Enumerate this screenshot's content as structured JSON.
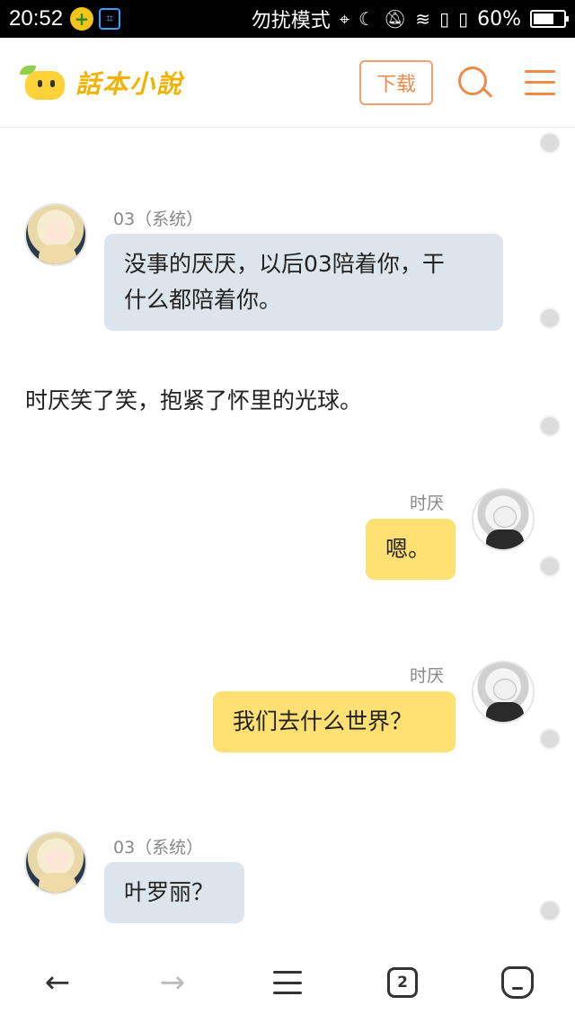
{
  "status_bar": {
    "time": "20:52",
    "mode": "勿扰模式",
    "battery": "60%",
    "battery_level": 0.6
  },
  "header": {
    "logo_text": "話本小說",
    "download_label": "下载"
  },
  "messages": [
    {
      "type": "bubble",
      "side": "left",
      "sender": "03（系统）",
      "lines": [
        "没事的厌厌，以后03陪着你，干",
        "什么都陪着你。"
      ]
    },
    {
      "type": "narration",
      "text": "时厌笑了笑，抱紧了怀里的光球。"
    },
    {
      "type": "bubble",
      "side": "right",
      "sender": "时厌",
      "lines": [
        "嗯。"
      ]
    },
    {
      "type": "bubble",
      "side": "right",
      "sender": "时厌",
      "lines": [
        "我们去什么世界？"
      ]
    },
    {
      "type": "bubble",
      "side": "left",
      "sender": "03（系统）",
      "lines": [
        "叶罗丽？"
      ]
    }
  ],
  "bottom_nav": {
    "tab_count": "2"
  },
  "icons": {
    "back": "back-arrow-icon",
    "forward": "forward-arrow-icon",
    "menu": "menu-icon",
    "tabs": "tabs-icon",
    "home": "home-icon"
  }
}
